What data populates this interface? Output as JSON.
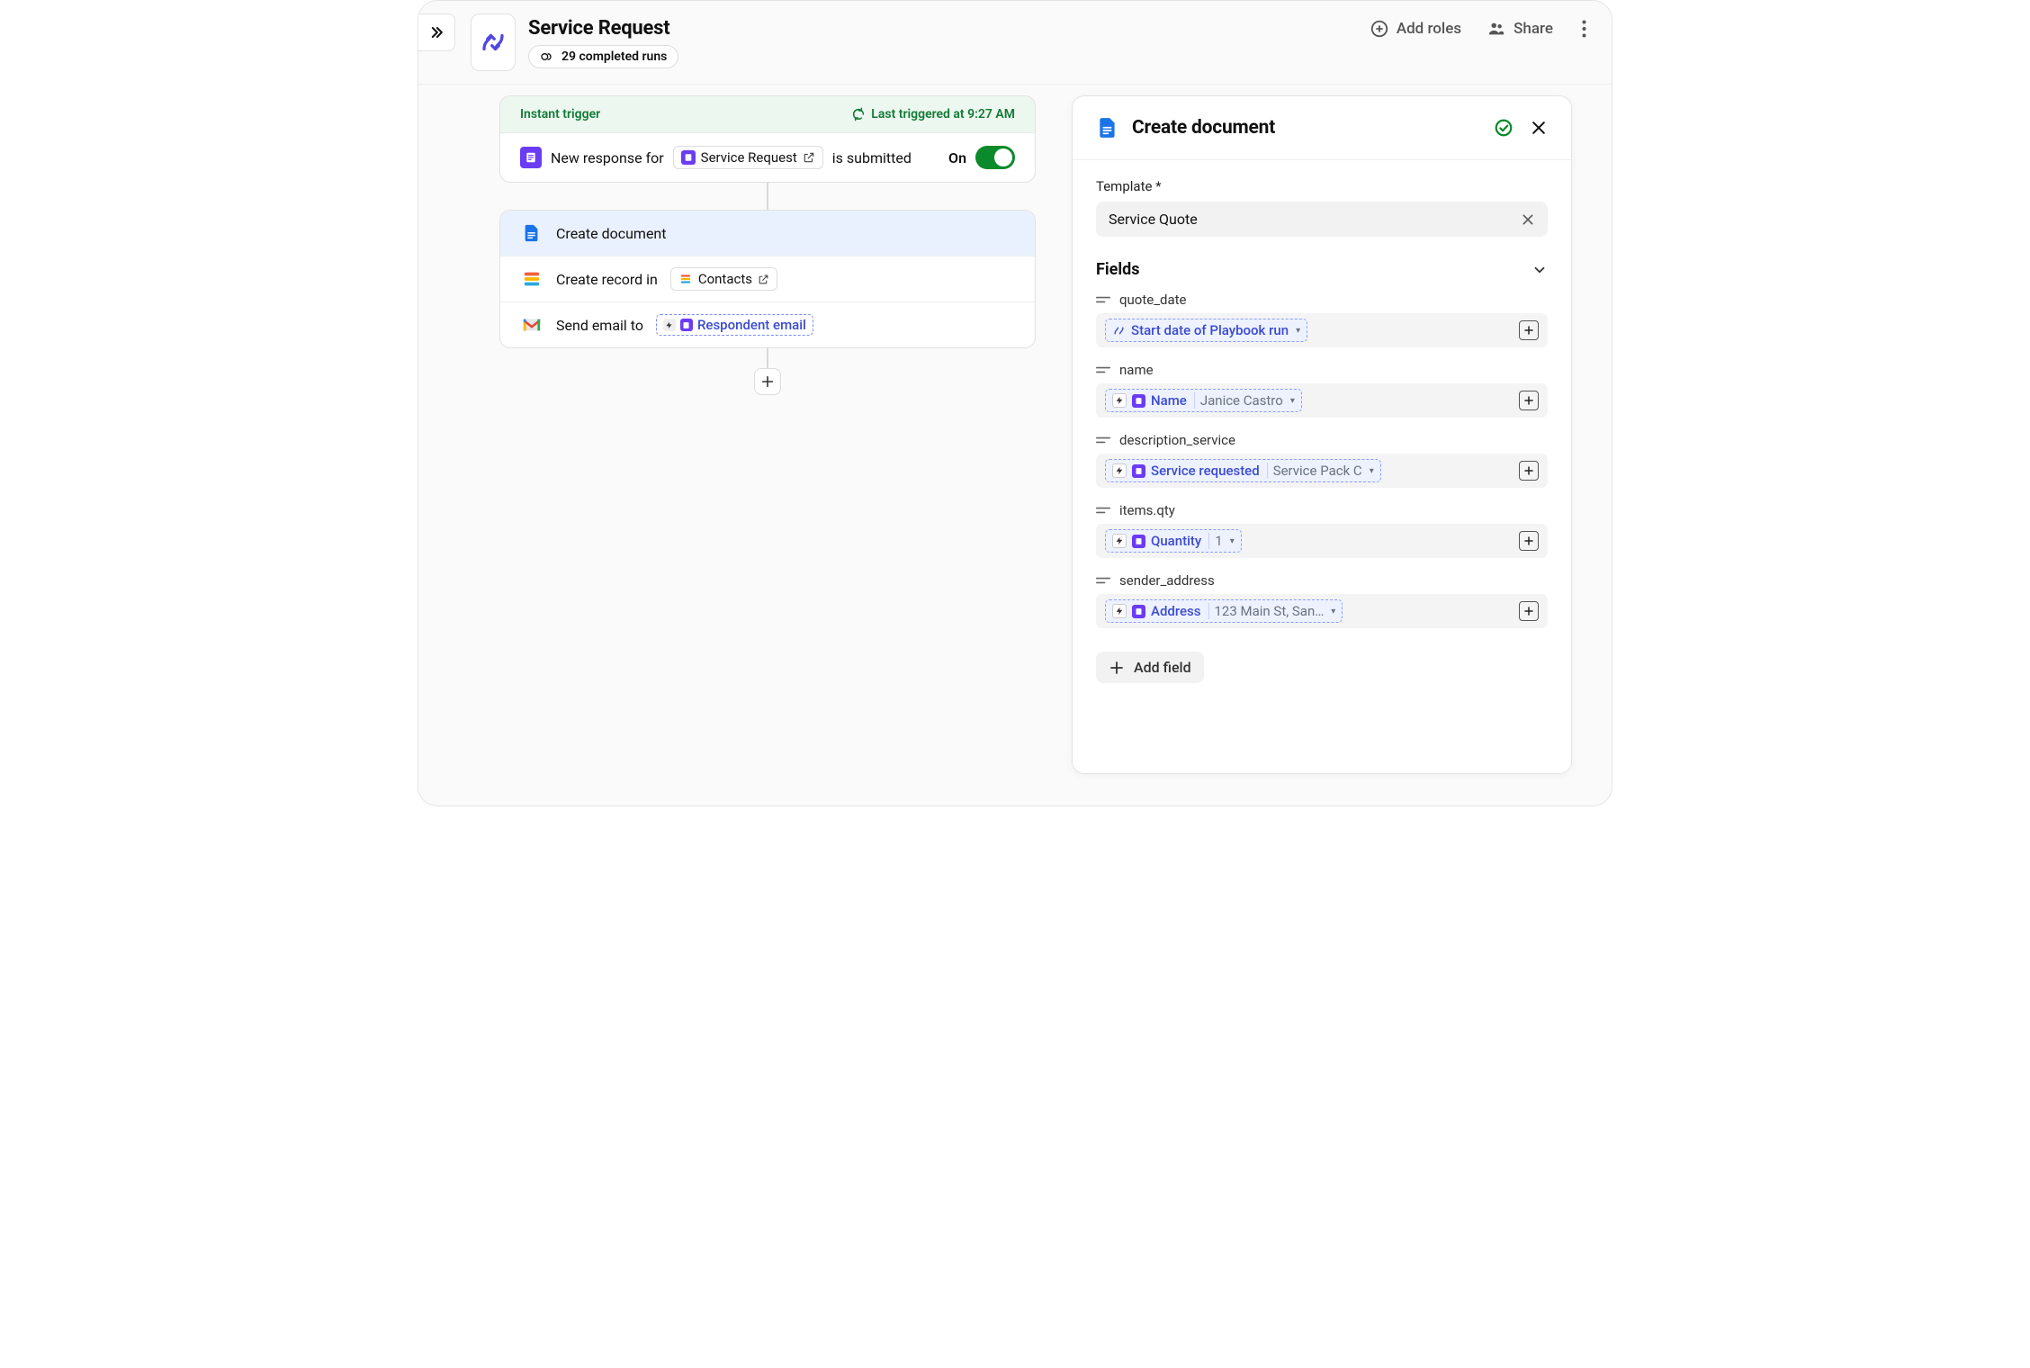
{
  "header": {
    "title": "Service Request",
    "runs_label": "29 completed runs",
    "add_roles": "Add roles",
    "share": "Share"
  },
  "trigger": {
    "head_label": "Instant trigger",
    "last_run": "Last triggered at 9:27 AM",
    "prefix": "New response for",
    "form_name": "Service Request",
    "suffix": "is submitted",
    "state_label": "On"
  },
  "steps": [
    {
      "index": "1",
      "label": "Create document"
    },
    {
      "index": "2",
      "prefix": "Create record in",
      "chip": "Contacts"
    },
    {
      "index": "3",
      "prefix": "Send email to",
      "var": "Respondent email"
    }
  ],
  "panel": {
    "title": "Create document",
    "template_label": "Template *",
    "template_value": "Service Quote",
    "fields_label": "Fields",
    "add_field": "Add field",
    "fields": [
      {
        "name": "quote_date",
        "token_type": "pb",
        "token_label": "Start date of Playbook run",
        "preview": ""
      },
      {
        "name": "name",
        "token_type": "form",
        "token_label": "Name",
        "preview": "Janice Castro"
      },
      {
        "name": "description_service",
        "token_type": "form",
        "token_label": "Service requested",
        "preview": "Service Pack C"
      },
      {
        "name": "items.qty",
        "token_type": "form",
        "token_label": "Quantity",
        "preview": "1"
      },
      {
        "name": "sender_address",
        "token_type": "form",
        "token_label": "Address",
        "preview": "123 Main St, San…"
      }
    ]
  }
}
